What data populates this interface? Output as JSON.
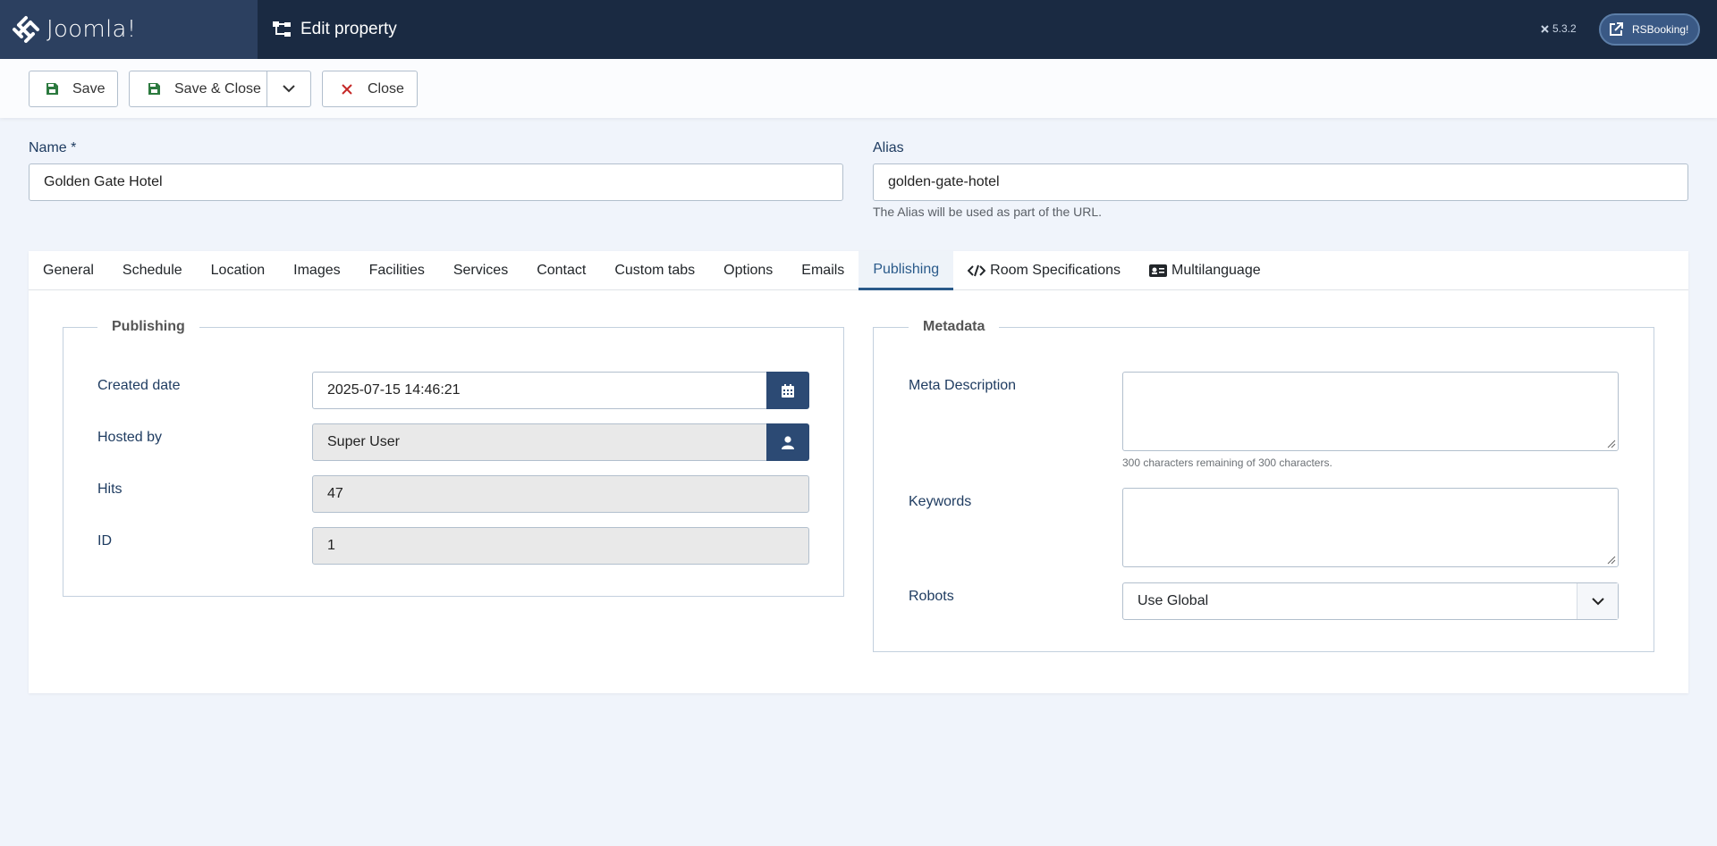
{
  "header": {
    "brand": "Joomla!",
    "page_title": "Edit property",
    "version": "5.3.2",
    "user_button": "RSBooking!"
  },
  "toolbar": {
    "save_label": "Save",
    "save_close_label": "Save & Close",
    "close_label": "Close"
  },
  "form": {
    "name_label": "Name *",
    "name_value": "Golden Gate Hotel",
    "alias_label": "Alias",
    "alias_value": "golden-gate-hotel",
    "alias_help": "The Alias will be used as part of the URL."
  },
  "tabs": [
    "General",
    "Schedule",
    "Location",
    "Images",
    "Facilities",
    "Services",
    "Contact",
    "Custom tabs",
    "Options",
    "Emails",
    "Publishing",
    "Room Specifications",
    "Multilanguage"
  ],
  "active_tab": "Publishing",
  "publishing": {
    "legend": "Publishing",
    "created_date_label": "Created date",
    "created_date_value": "2025-07-15 14:46:21",
    "hosted_by_label": "Hosted by",
    "hosted_by_value": "Super User",
    "hits_label": "Hits",
    "hits_value": "47",
    "id_label": "ID",
    "id_value": "1"
  },
  "metadata": {
    "legend": "Metadata",
    "meta_description_label": "Meta Description",
    "meta_description_value": "",
    "char_counter": "300 characters remaining of 300 characters.",
    "keywords_label": "Keywords",
    "keywords_value": "",
    "robots_label": "Robots",
    "robots_value": "Use Global"
  },
  "colors": {
    "header_bg": "#1a2a42",
    "accent": "#2c4a74",
    "close_icon": "#c52827",
    "save_icon": "#2c7a3f"
  }
}
